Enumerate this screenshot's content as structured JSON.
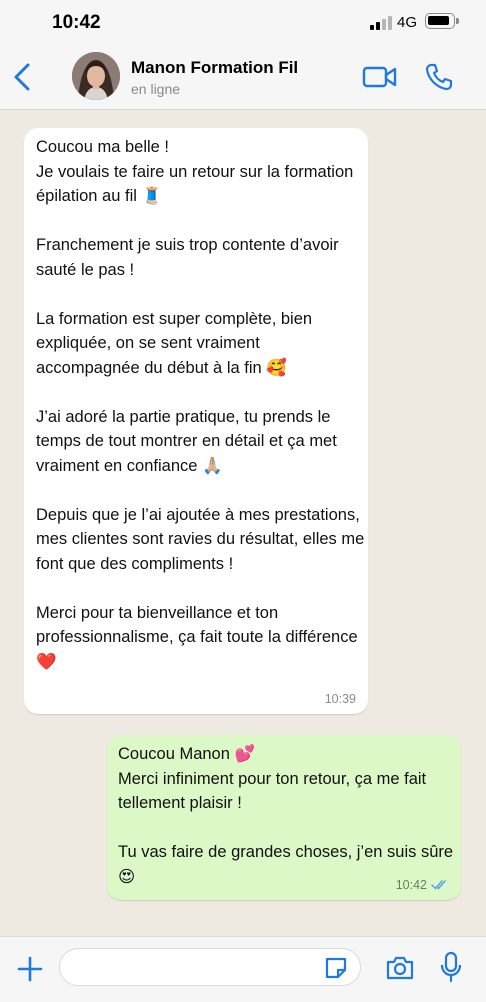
{
  "status_bar": {
    "time": "10:42",
    "network": "4G",
    "icons": [
      "signal-icon",
      "battery-icon"
    ]
  },
  "header": {
    "contact_name": "Manon Formation Fil",
    "contact_status": "en ligne",
    "icons": [
      "back-chevron-icon",
      "avatar",
      "video-call-icon",
      "phone-call-icon"
    ],
    "accent_color": "#1f7ae0"
  },
  "messages": [
    {
      "direction": "incoming",
      "text": "Coucou ma belle !\nJe voulais te faire un retour sur la formation épilation au fil 🧵\n\nFranchement je suis trop contente d’avoir sauté le pas !\n\nLa formation est super complète, bien expliquée, on se sent vraiment accompagnée du début à la fin 🥰\n\nJ’ai adoré la partie pratique, tu prends le temps de tout montrer en détail et ça met vraiment en confiance 🙏🏼\n\nDepuis que je l’ai ajoutée à mes prestations, mes clientes sont ravies du résultat, elles me font que des compliments !\n\nMerci pour ta bienveillance et ton professionnalisme, ça fait toute la différence ❤️",
      "time": "10:39"
    },
    {
      "direction": "outgoing",
      "text": "Coucou Manon 💕\nMerci infiniment pour ton retour, ça me fait tellement plaisir !\n\nTu vas faire de grandes choses, j’en suis sûre 😍",
      "time": "10:42",
      "status_icon": "read-double-check-icon"
    }
  ],
  "input_bar": {
    "placeholder": "",
    "icons": [
      "plus-icon",
      "sticker-icon",
      "camera-icon",
      "microphone-icon"
    ]
  },
  "colors": {
    "incoming_bubble": "#ffffff",
    "outgoing_bubble": "#dcf8c6",
    "chat_background": "#eeeae1",
    "bar_background": "#f6f6f6"
  }
}
